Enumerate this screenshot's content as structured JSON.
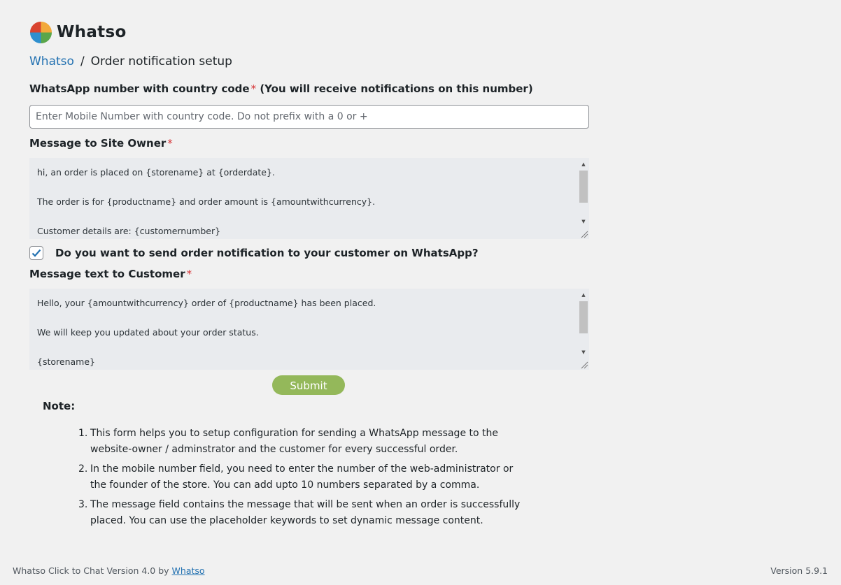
{
  "brand": {
    "logo_text": "Whatso",
    "logo_colors": [
      "#d9432f",
      "#f2a93b",
      "#2f8fce",
      "#5aa64a"
    ]
  },
  "breadcrumb": {
    "root": "Whatso",
    "separator": "/",
    "current": "Order notification setup"
  },
  "phone": {
    "label": "WhatsApp number with country code",
    "required_mark": "*",
    "hint": "(You will receive notifications on this number)",
    "value": "",
    "placeholder": "Enter Mobile Number with country code. Do not prefix with a 0 or +"
  },
  "owner_message": {
    "label": "Message to Site Owner",
    "required_mark": "*",
    "value": "hi, an order is placed on {storename} at {orderdate}.\n\nThe order is for {productname} and order amount is {amountwithcurrency}.\n\nCustomer details are: {customernumber}"
  },
  "customer_toggle": {
    "checked": true,
    "label": "Do you want to send order notification to your customer on WhatsApp?"
  },
  "customer_message": {
    "label": "Message text to Customer",
    "required_mark": "*",
    "value": "Hello, your {amountwithcurrency} order of {productname} has been placed.\n\nWe will keep you updated about your order status.\n\n{storename}"
  },
  "submit": {
    "label": "Submit",
    "color": "#94b85a"
  },
  "note": {
    "title": "Note:",
    "items": [
      {
        "num": "1.",
        "text": "This form helps you to setup configuration for sending a WhatsApp message to the website-owner / adminstrator and the customer for every successful order."
      },
      {
        "num": "2.",
        "text": "In the mobile number field, you need to enter the number of the web-administrator or the founder of the store. You can add upto 10 numbers separated by a comma."
      },
      {
        "num": "3.",
        "text": "The message field contains the message that will be sent when an order is successfully placed. You can use the placeholder keywords to set dynamic message content."
      }
    ]
  },
  "footer": {
    "left_text": "Whatso Click to Chat Version 4.0 by ",
    "left_link": "Whatso",
    "right_text": "Version 5.9.1"
  },
  "colors": {
    "link": "#2271b1",
    "required": "#d63638",
    "background": "#f1f1f1",
    "textarea_bg": "#e9ebee"
  }
}
